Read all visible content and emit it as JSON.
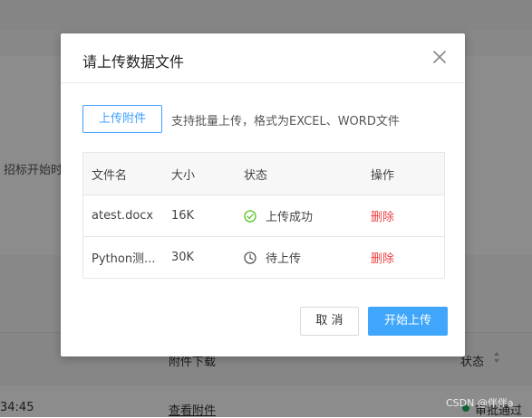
{
  "background": {
    "left_text": "招标开始时",
    "table_header": {
      "attachment": "附件下载",
      "status": "状态"
    },
    "row": {
      "time": "34:45",
      "view_link": "查看附件",
      "status": "审批通过"
    },
    "watermark": "CSDN @伴伴a"
  },
  "modal": {
    "title": "请上传数据文件",
    "upload_button": "上传附件",
    "hint": "支持批量上传，格式为EXCEL、WORD文件",
    "table": {
      "columns": [
        "文件名",
        "大小",
        "状态",
        "操作"
      ],
      "rows": [
        {
          "name": "atest.docx",
          "size": "16K",
          "status": "上传成功",
          "status_icon": "check-circle-icon",
          "action": "删除"
        },
        {
          "name": "Python测...",
          "size": "30K",
          "status": "待上传",
          "status_icon": "clock-icon",
          "action": "删除"
        }
      ]
    },
    "cancel_button": "取 消",
    "start_button": "开始上传"
  },
  "colors": {
    "primary": "#409eff",
    "start_button": "#3fa6fb",
    "success": "#52c41a",
    "danger": "#ee3f3f",
    "overlay": "rgba(0,0,0,0.45)"
  }
}
